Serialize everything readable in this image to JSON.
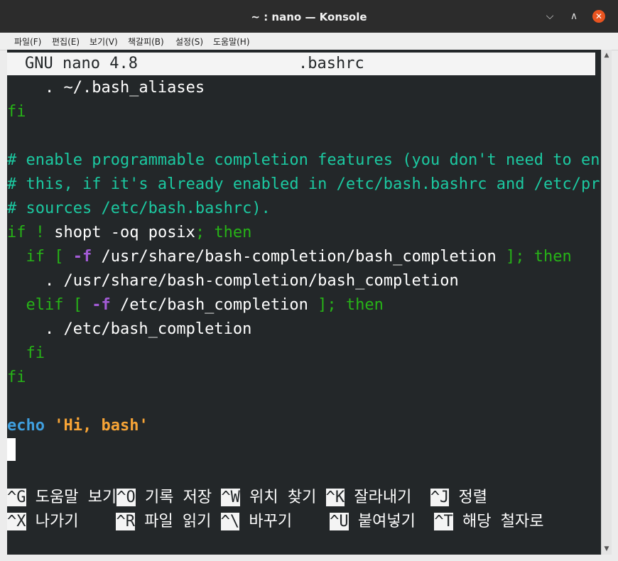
{
  "window": {
    "title": "~ : nano — Konsole",
    "controls": {
      "minimize": "⌵",
      "maximize": "∧",
      "close": "✕"
    }
  },
  "menu": [
    {
      "label": "파일(F)"
    },
    {
      "label": "편집(E)"
    },
    {
      "label": "보기(V)"
    },
    {
      "label": "책갈피(B)"
    },
    {
      "label": "설정(S)"
    },
    {
      "label": "도움말(H)"
    }
  ],
  "nano": {
    "version": "GNU nano 4.8",
    "filename": ".bashrc"
  },
  "code": {
    "l1": "    . ~/.bash_aliases",
    "l2": "fi",
    "c1": "# enable programmable completion features (you don't need to enable",
    "c2": "# this, if it's already enabled in /etc/bash.bashrc and /etc/profile",
    "c3": "# sources /etc/bash.bashrc).",
    "if": "if",
    "bang": " ! ",
    "shopt": "shopt -oq posix",
    "semi": ";",
    "then": "then",
    "ifkw2": "  if",
    "br_open": " [ ",
    "flag": "-f",
    "path1": " /usr/share/bash-completion/bash_completion ",
    "br_close": "];",
    "source1": "    . /usr/share/bash-completion/bash_completion",
    "elif": "  elif",
    "path2": " /etc/bash_completion ",
    "source2": "    . /etc/bash_completion",
    "fi_in": "  fi",
    "fi_out": "fi",
    "echo": "echo",
    "str": "'Hi, bash'"
  },
  "shortcuts": {
    "row1": [
      {
        "key": "^G",
        "label": " 도움말 보기"
      },
      {
        "key": "^O",
        "label": " 기록 저장 "
      },
      {
        "key": "^W",
        "label": " 위치 찾기 "
      },
      {
        "key": "^K",
        "label": " 잘라내기  "
      },
      {
        "key": "^J",
        "label": " 정렬"
      }
    ],
    "row2": [
      {
        "key": "^X",
        "label": " 나가기    "
      },
      {
        "key": "^R",
        "label": " 파일 읽기 "
      },
      {
        "key": "^\\",
        "label": " 바꾸기    "
      },
      {
        "key": "^U",
        "label": " 붙여넣기  "
      },
      {
        "key": "^T",
        "label": " 해당 철자로"
      }
    ]
  },
  "colors": {
    "terminal_bg": "#232729",
    "keyword": "#27b317",
    "comment": "#1cc9a1",
    "flag": "#a35bd6",
    "builtin": "#3f9fdf",
    "string": "#f7a436"
  }
}
